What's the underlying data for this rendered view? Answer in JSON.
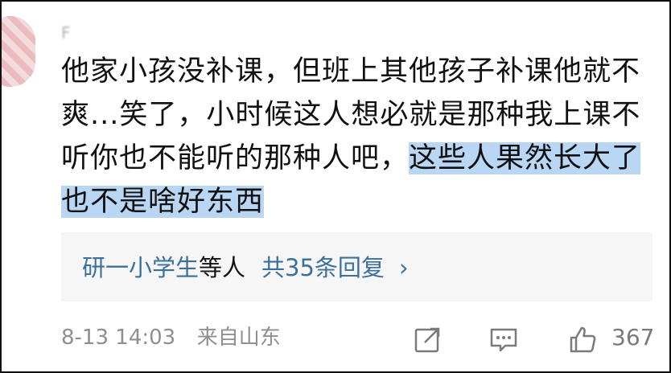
{
  "comment": {
    "username": "F        ",
    "text_normal": "他家小孩没补课，但班上其他孩子补课他就不爽...笑了，小时候这人想必就是那种我上课不听你也不能听的那种人吧，",
    "text_highlight": "这些人果然长大了也不是啥好东西"
  },
  "replies": {
    "names": "研一小学生",
    "middle": "等人",
    "summary": "共35条回复",
    "chevron": "›"
  },
  "footer": {
    "date": "8-13 14:03",
    "location": "来自山东",
    "like_count": "367",
    "icons": [
      "share-icon",
      "comment-icon",
      "like-icon"
    ]
  },
  "colors": {
    "highlight": "#b9d7f5",
    "link": "#3b6f9c",
    "muted": "#8f8f8f"
  }
}
